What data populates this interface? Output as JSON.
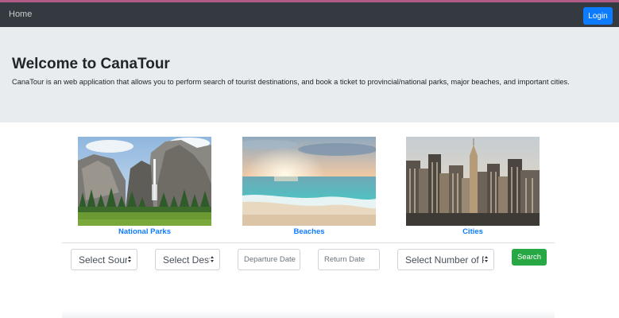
{
  "colors": {
    "navbar_bg": "#343a40",
    "accent_stripe": "#b15c87",
    "primary": "#0d7bff",
    "success": "#28a745",
    "jumbotron_bg": "#e9ecef"
  },
  "navbar": {
    "home_label": "Home",
    "login_label": "Login"
  },
  "jumbotron": {
    "title": "Welcome to CanaTour",
    "description": "CanaTour is an web application that allows you to perform search of tourist destinations, and book a ticket to provincial/national parks, major beaches, and important cities."
  },
  "categories": [
    {
      "label": "National Parks",
      "image": "waterfall-valley-photo"
    },
    {
      "label": "Beaches",
      "image": "beach-sunset-photo"
    },
    {
      "label": "Cities",
      "image": "city-skyline-photo"
    }
  ],
  "search_form": {
    "source_value": "Select Source",
    "destination_value": "Select Destination",
    "departure_placeholder": "Departure Date",
    "return_placeholder": "Return Date",
    "passengers_value": "Select Number of Passengers",
    "search_label": "Search"
  }
}
